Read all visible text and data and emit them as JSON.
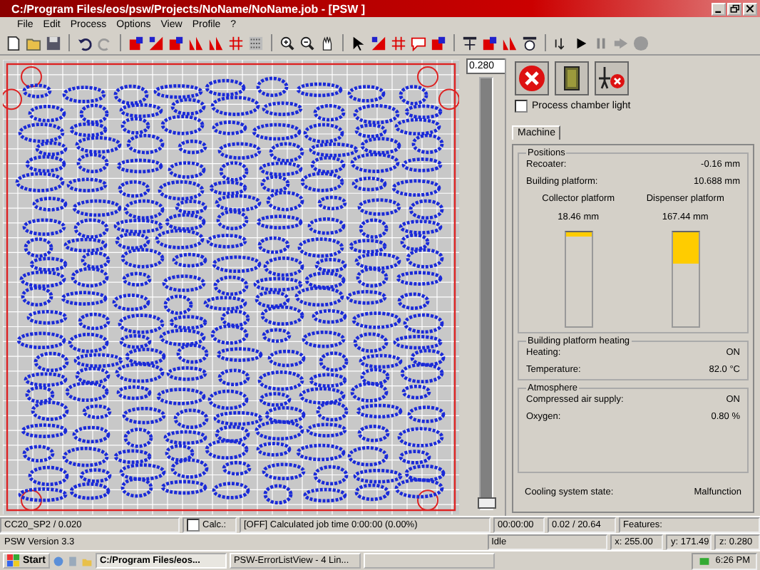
{
  "window": {
    "title": "C:/Program Files/eos/psw/Projects/NoName/NoName.job - [PSW ]"
  },
  "menu": [
    "File",
    "Edit",
    "Process",
    "Options",
    "View",
    "Profile",
    "?"
  ],
  "layer_slider": {
    "value": "0.280",
    "level": 0
  },
  "panel": {
    "chamber_light": {
      "label": "Process chamber light",
      "checked": false
    },
    "tabs": [
      {
        "label": "Machine",
        "selected": true
      }
    ],
    "positions": {
      "title": "Positions",
      "rows": [
        {
          "label": "Recoater:",
          "value": "-0.16 mm"
        },
        {
          "label": "Building platform:",
          "value": "10.688 mm"
        }
      ],
      "gauges": [
        {
          "label": "Collector platform",
          "value": "18.46 mm",
          "level": 0.05
        },
        {
          "label": "Dispenser platform",
          "value": "167.44 mm",
          "level": 0.33
        }
      ]
    },
    "heating": {
      "title": "Building platform heating",
      "rows": [
        {
          "label": "Heating:",
          "value": "ON"
        },
        {
          "label": "Temperature:",
          "value": "82.0 °C"
        }
      ]
    },
    "atmosphere": {
      "title": "Atmosphere",
      "rows": [
        {
          "label": "Compressed air supply:",
          "value": "ON"
        },
        {
          "label": "Oxygen:",
          "value": "0.80 %"
        }
      ]
    },
    "cooling": {
      "label": "Cooling system state:",
      "value": "Malfunction"
    }
  },
  "status_bar": {
    "material": "CC20_SP2 / 0.020",
    "calc": {
      "label": "Calc.:",
      "checked": false
    },
    "job_time": "[OFF] Calculated job time 0:00:00 (0.00%)",
    "time": "00:00:00",
    "layers": "0.02 / 20.64",
    "features": "Features:"
  },
  "version_bar": {
    "version": "PSW Version 3.3",
    "state": "Idle",
    "x": "x: 255.00",
    "y": "y: 171.49",
    "z": "z: 0.280"
  },
  "taskbar": {
    "start": "Start",
    "tasks": [
      {
        "label": "C:/Program Files/eos...",
        "selected": true
      },
      {
        "label": "PSW-ErrorListView - 4 Lin...",
        "selected": false
      }
    ],
    "clock": "6:26 PM"
  }
}
